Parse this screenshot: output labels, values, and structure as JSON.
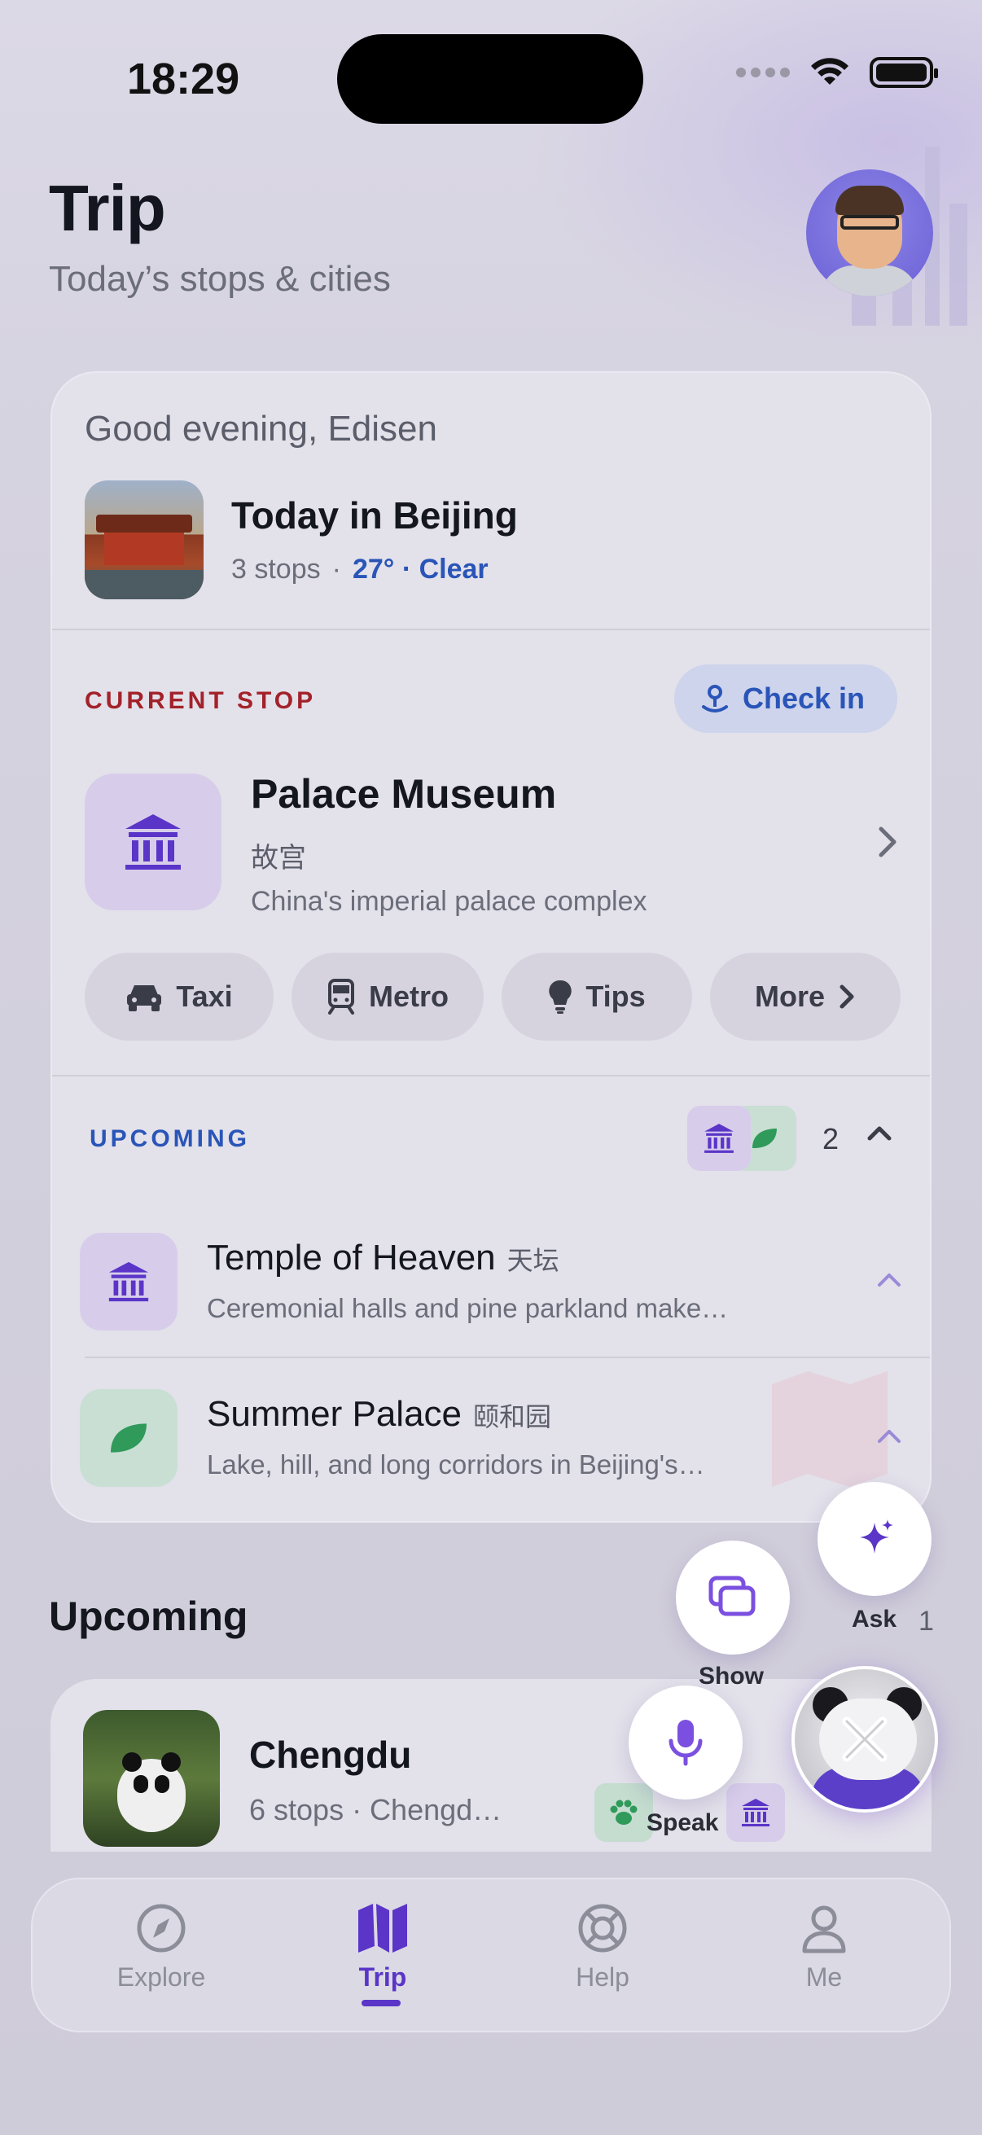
{
  "status": {
    "time": "18:29"
  },
  "header": {
    "title": "Trip",
    "subtitle": "Today’s stops & cities"
  },
  "today": {
    "greeting": "Good evening, Edisen",
    "city": "Today in Beijing",
    "stops": "3 stops",
    "sep": "·",
    "weather": "27° · Clear"
  },
  "current": {
    "label": "CURRENT STOP",
    "checkin": "Check in",
    "name": "Palace Museum",
    "name_cn": "故宫",
    "desc": "China's imperial palace complex",
    "chips": [
      {
        "label": "Taxi",
        "icon": "car-icon"
      },
      {
        "label": "Metro",
        "icon": "train-icon"
      },
      {
        "label": "Tips",
        "icon": "lightbulb-icon"
      },
      {
        "label": "More",
        "icon": "chevron-right-icon"
      }
    ]
  },
  "upcoming_card": {
    "label": "UPCOMING",
    "count": "2",
    "items": [
      {
        "name": "Temple of Heaven",
        "cn": "天坛",
        "desc": "Ceremonial halls and pine parkland make…"
      },
      {
        "name": "Summer Palace",
        "cn": "颐和园",
        "desc": "Lake, hill, and long corridors in Beijing's…"
      }
    ]
  },
  "upcoming_section": {
    "title": "Upcoming",
    "trip": {
      "name": "Chengdu",
      "meta": "6 stops · Chengd…"
    }
  },
  "fabs": {
    "ask": "Ask",
    "ask_badge": "1",
    "show": "Show",
    "speak": "Speak"
  },
  "tabs": [
    {
      "label": "Explore",
      "icon": "compass-icon"
    },
    {
      "label": "Trip",
      "icon": "map-icon"
    },
    {
      "label": "Help",
      "icon": "lifebuoy-icon"
    },
    {
      "label": "Me",
      "icon": "person-icon"
    }
  ],
  "colors": {
    "accent": "#5a35c8",
    "link": "#2a55b8",
    "alert": "#a3222a",
    "green": "#2f9a5a"
  }
}
